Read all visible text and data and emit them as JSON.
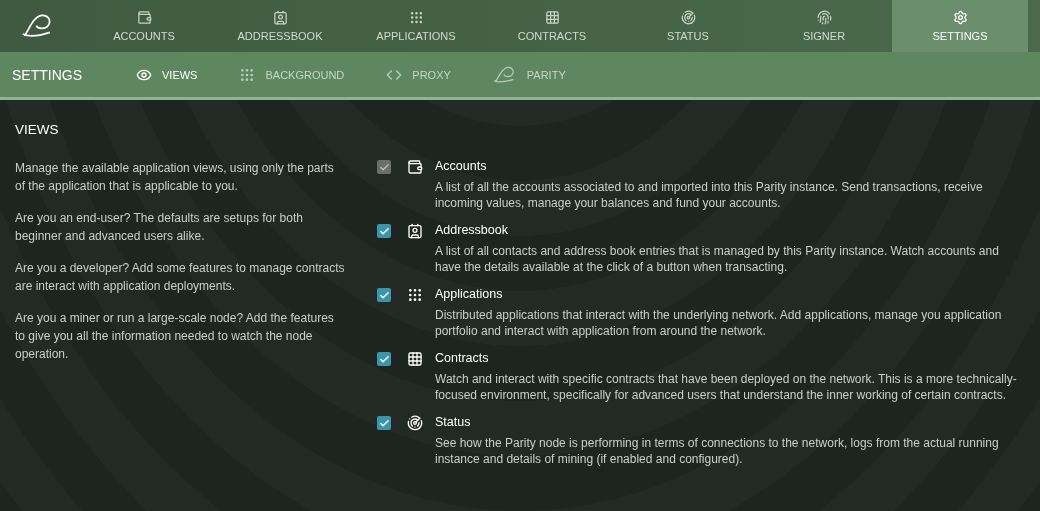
{
  "nav": {
    "tabs": [
      {
        "label": "ACCOUNTS",
        "selected": false
      },
      {
        "label": "ADDRESSBOOK",
        "selected": false
      },
      {
        "label": "APPLICATIONS",
        "selected": false
      },
      {
        "label": "CONTRACTS",
        "selected": false
      },
      {
        "label": "STATUS",
        "selected": false
      },
      {
        "label": "SIGNER",
        "selected": false
      },
      {
        "label": "SETTINGS",
        "selected": true
      }
    ]
  },
  "subnav": {
    "title": "SETTINGS",
    "tabs": [
      {
        "label": "VIEWS",
        "selected": true
      },
      {
        "label": "BACKGROUND",
        "selected": false
      },
      {
        "label": "PROXY",
        "selected": false
      },
      {
        "label": "PARITY",
        "selected": false
      }
    ]
  },
  "section": {
    "title": "VIEWS",
    "paragraphs": [
      "Manage the available application views, using only the parts of the application that is applicable to you.",
      "Are you an end-user? The defaults are setups for both beginner and advanced users alike.",
      "Are you a developer? Add some features to manage contracts are interact with application deployments.",
      "Are you a miner or run a large-scale node? Add the features to give you all the information needed to watch the node operation."
    ],
    "views": [
      {
        "name": "Accounts",
        "checked": true,
        "disabled": true,
        "description": "A list of all the accounts associated to and imported into this Parity instance. Send transactions, receive incoming values, manage your balances and fund your accounts."
      },
      {
        "name": "Addressbook",
        "checked": true,
        "disabled": false,
        "description": "A list of all contacts and address book entries that is managed by this Parity instance. Watch accounts and have the details available at the click of a button when transacting."
      },
      {
        "name": "Applications",
        "checked": true,
        "disabled": false,
        "description": "Distributed applications that interact with the underlying network. Add applications, manage you application portfolio and interact with application from around the network."
      },
      {
        "name": "Contracts",
        "checked": true,
        "disabled": false,
        "description": "Watch and interact with specific contracts that have been deployed on the network. This is a more technically-focused environment, specifically for advanced users that understand the inner working of certain contracts."
      },
      {
        "name": "Status",
        "checked": true,
        "disabled": false,
        "description": "See how the Parity node is performing in terms of connections to the network, logs from the actual running instance and details of mining (if enabled and configured)."
      }
    ]
  }
}
